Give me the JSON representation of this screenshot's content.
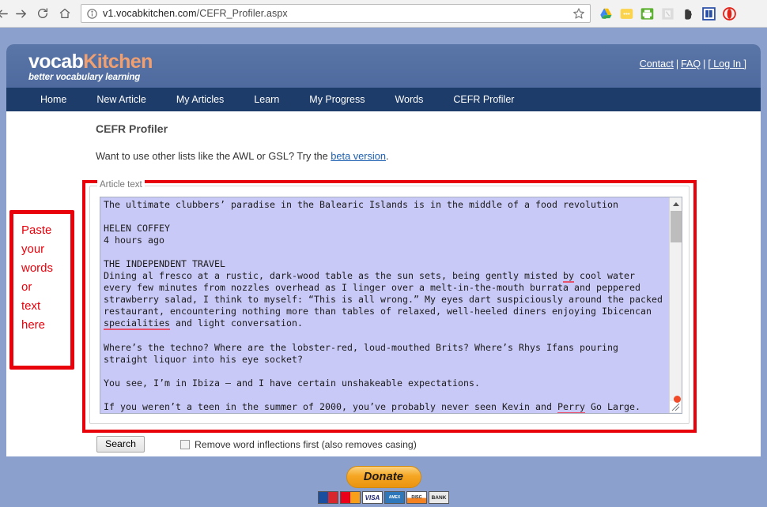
{
  "browser": {
    "url_prefix": "v1.vocabkitchen.com",
    "url_suffix": "/CEFR_Profiler.aspx",
    "back_icon": "back-arrow-icon",
    "forward_icon": "forward-arrow-icon",
    "reload_icon": "reload-icon",
    "home_icon": "home-icon",
    "info_icon": "info-circle-icon",
    "bookmark_icon": "star-icon",
    "extensions": [
      "google-drive-icon",
      "yellow-dots-icon",
      "green-printer-icon",
      "gray-page-icon",
      "evernote-icon",
      "blue-reader-icon",
      "opera-icon"
    ]
  },
  "site": {
    "logo_first": "vocab",
    "logo_second": "Kitchen",
    "tagline": "better vocabulary learning",
    "header_links": [
      {
        "label": "Contact"
      },
      {
        "label": "FAQ"
      },
      {
        "label": "[ Log In ]"
      }
    ],
    "nav": [
      {
        "label": "Home"
      },
      {
        "label": "New Article"
      },
      {
        "label": "My Articles"
      },
      {
        "label": "Learn"
      },
      {
        "label": "My Progress"
      },
      {
        "label": "Words"
      },
      {
        "label": "CEFR Profiler"
      }
    ]
  },
  "main": {
    "page_title": "CEFR Profiler",
    "beta_prefix": "Want to use other lists like the AWL or GSL? Try the ",
    "beta_link": "beta version",
    "beta_suffix": ".",
    "fieldset_legend": "Article text",
    "article_lines": {
      "l1": "The ultimate clubbers’ paradise in the Balearic Islands is in the middle of a food revolution",
      "l2": "",
      "l3": "HELEN COFFEY",
      "l4": "4 hours ago",
      "l5": "",
      "l6": "THE INDEPENDENT TRAVEL",
      "l7a": "Dining al fresco at a rustic, dark-wood table as the sun sets, being gently misted ",
      "l7b": "by",
      "l7c": " cool water every few minutes from nozzles overhead as I linger over a melt-in-the-mouth burrata and peppered strawberry salad, I think to myself: “This is all wrong.” My eyes dart suspiciously around the packed restaurant, encountering nothing more than tables of relaxed, well-heeled diners enjoying Ibicencan ",
      "l7d": "specialities",
      "l7e": " and light conversation.",
      "l8": "",
      "l9": "Where’s the techno? Where are the lobster-red, loud-mouthed Brits? Where’s Rhys Ifans pouring straight liquor into his eye socket?",
      "l10": "",
      "l11": "You see, I’m in Ibiza – and I have certain unshakeable expectations.",
      "l12": "",
      "l13a": "If you weren’t a teen in the summer of 2000, you’ve probably never seen Kevin and ",
      "l13b": "Perry",
      "l13c": " Go Large."
    },
    "search_button": "Search",
    "checkbox_label": "Remove word inflections first (also removes casing)",
    "checkbox_checked": false
  },
  "annotation": {
    "line1": "Paste",
    "line2": "your",
    "line3": "words",
    "line4": "or",
    "line5": "text",
    "line6": "here",
    "color": "#e8000b"
  },
  "footer": {
    "donate_label": "Donate",
    "cards": [
      {
        "label": "Maestro",
        "short": "maestro"
      },
      {
        "label": "MasterCard",
        "short": ""
      },
      {
        "label": "VISA",
        "short": "VISA"
      },
      {
        "label": "American Express",
        "short": "AMEX"
      },
      {
        "label": "Discover",
        "short": "DISC"
      },
      {
        "label": "BANK",
        "short": "BANK"
      }
    ]
  },
  "colors": {
    "page_background": "#8ba0cc",
    "header_blue": "#4e6a9e",
    "nav_blue": "#1e3c69",
    "logo_accent": "#f0a070",
    "annotation_red": "#e8000b",
    "selection": "#c9c9f7"
  }
}
